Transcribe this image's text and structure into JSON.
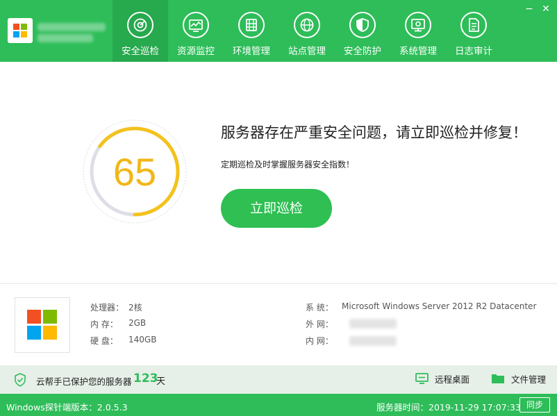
{
  "header": {
    "nav": [
      {
        "label": "安全巡检",
        "icon": "security-scan-icon",
        "active": true
      },
      {
        "label": "资源监控",
        "icon": "resource-monitor-icon"
      },
      {
        "label": "环境管理",
        "icon": "environment-icon"
      },
      {
        "label": "站点管理",
        "icon": "site-globe-icon"
      },
      {
        "label": "安全防护",
        "icon": "shield-icon"
      },
      {
        "label": "系统管理",
        "icon": "system-monitor-icon"
      },
      {
        "label": "日志审计",
        "icon": "log-document-icon"
      }
    ],
    "window": {
      "minimize": "−",
      "close": "✕"
    }
  },
  "main": {
    "score": "65",
    "headline": "服务器存在严重安全问题，请立即巡检并修复！",
    "subline": "定期巡检及时掌握服务器安全指数！",
    "scan_button": "立即巡检"
  },
  "info": {
    "cpu_label": "处理器：",
    "cpu_value": "2核",
    "mem_label": "内 存：",
    "mem_value": "2GB",
    "disk_label": "硬 盘：",
    "disk_value": "140GB",
    "os_label": "系 统：",
    "os_value": "Microsoft Windows Server 2012 R2 Datacenter",
    "wan_label": "外 网：",
    "lan_label": "内 网："
  },
  "status": {
    "protect_text": "云帮手已保护您的服务器",
    "days": "123",
    "days_unit": "天",
    "remote_desktop": "远程桌面",
    "file_manager": "文件管理"
  },
  "footer": {
    "version": "Windows探针端版本：2.0.5.3",
    "server_time": "服务器时间：2019-11-29 17:07:33",
    "sync": "同步"
  },
  "colors": {
    "brand_green": "#2ebd59",
    "active_tab": "#27a94e",
    "score_ring": "#f4c21d",
    "status_bg": "#e6efe8"
  }
}
